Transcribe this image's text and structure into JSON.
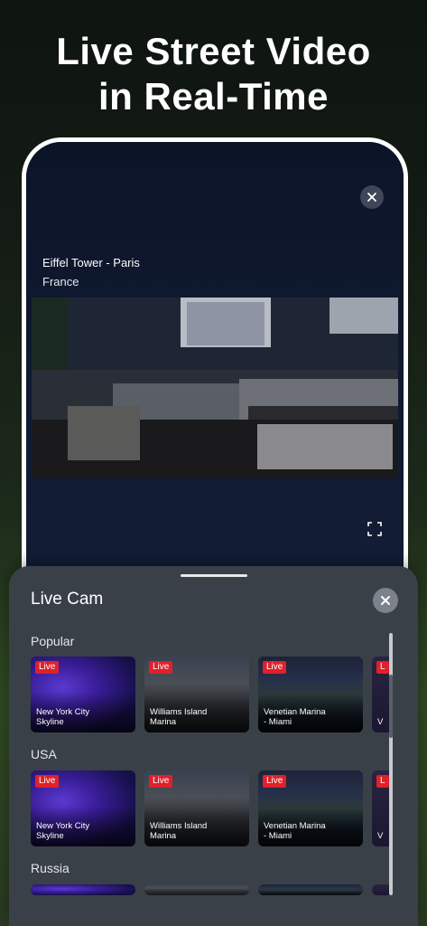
{
  "headline": {
    "line1": "Live Street Video",
    "line2": "in Real-Time"
  },
  "player": {
    "title": "Eiffel Tower - Paris",
    "subtitle": "France",
    "close_icon": "close-icon",
    "fullscreen_icon": "fullscreen-icon"
  },
  "sheet": {
    "title": "Live Cam",
    "close_icon": "close-icon",
    "sections": [
      {
        "label": "Popular",
        "cards": [
          {
            "badge": "Live",
            "name_line1": "New York City",
            "name_line2": "Skyline"
          },
          {
            "badge": "Live",
            "name_line1": "Williams Island",
            "name_line2": "Marina"
          },
          {
            "badge": "Live",
            "name_line1": "Venetian Marina",
            "name_line2": "- Miami"
          },
          {
            "badge": "L",
            "name_line1": "V",
            "name_line2": ""
          }
        ]
      },
      {
        "label": "USA",
        "cards": [
          {
            "badge": "Live",
            "name_line1": "New York City",
            "name_line2": "Skyline"
          },
          {
            "badge": "Live",
            "name_line1": "Williams Island",
            "name_line2": "Marina"
          },
          {
            "badge": "Live",
            "name_line1": "Venetian Marina",
            "name_line2": "- Miami"
          },
          {
            "badge": "L",
            "name_line1": "V",
            "name_line2": ""
          }
        ]
      },
      {
        "label": "Russia",
        "cards": []
      }
    ]
  },
  "colors": {
    "live_badge": "#e0202a",
    "sheet_bg": "#3a4048"
  }
}
